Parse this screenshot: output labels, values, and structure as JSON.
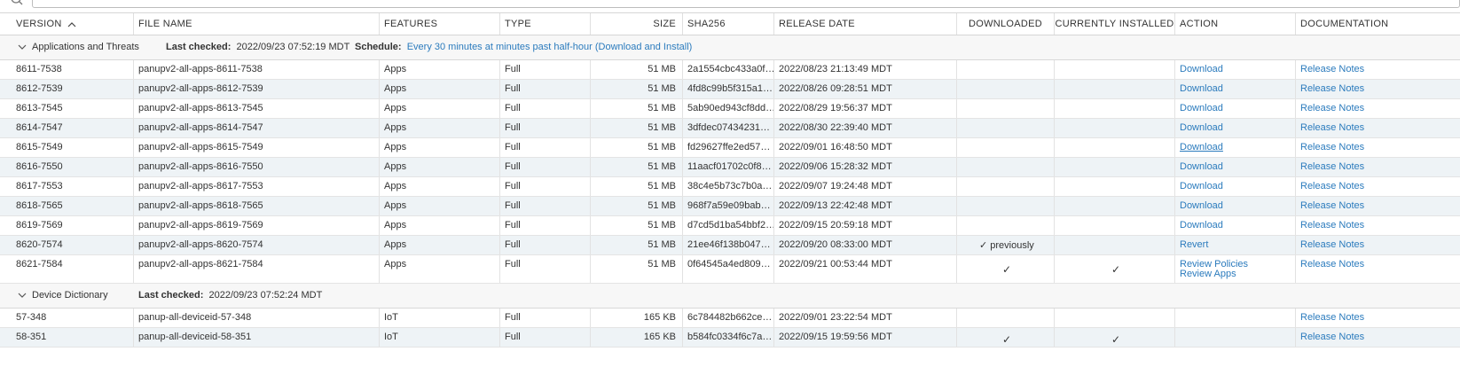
{
  "headers": {
    "version": "VERSION",
    "file_name": "FILE NAME",
    "features": "FEATURES",
    "type": "TYPE",
    "size": "SIZE",
    "sha256": "SHA256",
    "release_date": "RELEASE DATE",
    "downloaded": "DOWNLOADED",
    "currently_installed": "CURRENTLY INSTALLED",
    "action": "ACTION",
    "documentation": "DOCUMENTATION"
  },
  "groups": [
    {
      "name": "Applications and Threats",
      "last_checked_label": "Last checked:",
      "last_checked_value": "2022/09/23 07:52:19 MDT",
      "schedule_label": "Schedule:",
      "schedule_value": "Every 30 minutes at minutes past half-hour (Download and Install)",
      "rows": [
        {
          "version": "8611-7538",
          "file": "panupv2-all-apps-8611-7538",
          "features": "Apps",
          "type": "Full",
          "size": "51 MB",
          "sha": "2a1554cbc433a0f…",
          "date": "2022/08/23 21:13:49 MDT",
          "downloaded": "",
          "installed": "",
          "action": "Download",
          "action2": "",
          "doc": "Release Notes"
        },
        {
          "version": "8612-7539",
          "file": "panupv2-all-apps-8612-7539",
          "features": "Apps",
          "type": "Full",
          "size": "51 MB",
          "sha": "4fd8c99b5f315a1…",
          "date": "2022/08/26 09:28:51 MDT",
          "downloaded": "",
          "installed": "",
          "action": "Download",
          "action2": "",
          "doc": "Release Notes"
        },
        {
          "version": "8613-7545",
          "file": "panupv2-all-apps-8613-7545",
          "features": "Apps",
          "type": "Full",
          "size": "51 MB",
          "sha": "5ab90ed943cf8dd…",
          "date": "2022/08/29 19:56:37 MDT",
          "downloaded": "",
          "installed": "",
          "action": "Download",
          "action2": "",
          "doc": "Release Notes"
        },
        {
          "version": "8614-7547",
          "file": "panupv2-all-apps-8614-7547",
          "features": "Apps",
          "type": "Full",
          "size": "51 MB",
          "sha": "3dfdec07434231…",
          "date": "2022/08/30 22:39:40 MDT",
          "downloaded": "",
          "installed": "",
          "action": "Download",
          "action2": "",
          "doc": "Release Notes"
        },
        {
          "version": "8615-7549",
          "file": "panupv2-all-apps-8615-7549",
          "features": "Apps",
          "type": "Full",
          "size": "51 MB",
          "sha": "fd29627ffe2ed57…",
          "date": "2022/09/01 16:48:50 MDT",
          "downloaded": "",
          "installed": "",
          "action": "Download",
          "action2": "",
          "doc": "Release Notes",
          "hover": true
        },
        {
          "version": "8616-7550",
          "file": "panupv2-all-apps-8616-7550",
          "features": "Apps",
          "type": "Full",
          "size": "51 MB",
          "sha": "11aacf01702c0f8…",
          "date": "2022/09/06 15:28:32 MDT",
          "downloaded": "",
          "installed": "",
          "action": "Download",
          "action2": "",
          "doc": "Release Notes"
        },
        {
          "version": "8617-7553",
          "file": "panupv2-all-apps-8617-7553",
          "features": "Apps",
          "type": "Full",
          "size": "51 MB",
          "sha": "38c4e5b73c7b0a…",
          "date": "2022/09/07 19:24:48 MDT",
          "downloaded": "",
          "installed": "",
          "action": "Download",
          "action2": "",
          "doc": "Release Notes"
        },
        {
          "version": "8618-7565",
          "file": "panupv2-all-apps-8618-7565",
          "features": "Apps",
          "type": "Full",
          "size": "51 MB",
          "sha": "968f7a59e09bab…",
          "date": "2022/09/13 22:42:48 MDT",
          "downloaded": "",
          "installed": "",
          "action": "Download",
          "action2": "",
          "doc": "Release Notes"
        },
        {
          "version": "8619-7569",
          "file": "panupv2-all-apps-8619-7569",
          "features": "Apps",
          "type": "Full",
          "size": "51 MB",
          "sha": "d7cd5d1ba54bbf2…",
          "date": "2022/09/15 20:59:18 MDT",
          "downloaded": "",
          "installed": "",
          "action": "Download",
          "action2": "",
          "doc": "Release Notes"
        },
        {
          "version": "8620-7574",
          "file": "panupv2-all-apps-8620-7574",
          "features": "Apps",
          "type": "Full",
          "size": "51 MB",
          "sha": "21ee46f138b047…",
          "date": "2022/09/20 08:33:00 MDT",
          "downloaded": "✓ previously",
          "installed": "",
          "action": "Revert",
          "action2": "",
          "doc": "Release Notes"
        },
        {
          "version": "8621-7584",
          "file": "panupv2-all-apps-8621-7584",
          "features": "Apps",
          "type": "Full",
          "size": "51 MB",
          "sha": "0f64545a4ed809…",
          "date": "2022/09/21 00:53:44 MDT",
          "downloaded": "✓",
          "installed": "✓",
          "action": "Review Policies",
          "action2": "Review Apps",
          "doc": "Release Notes"
        }
      ]
    },
    {
      "name": "Device Dictionary",
      "last_checked_label": "Last checked:",
      "last_checked_value": "2022/09/23 07:52:24 MDT",
      "rows": [
        {
          "version": "57-348",
          "file": "panup-all-deviceid-57-348",
          "features": "IoT",
          "type": "Full",
          "size": "165 KB",
          "sha": "6c784482b662ce…",
          "date": "2022/09/01 23:22:54 MDT",
          "downloaded": "",
          "installed": "",
          "action": "",
          "action2": "",
          "doc": "Release Notes"
        },
        {
          "version": "58-351",
          "file": "panup-all-deviceid-58-351",
          "features": "IoT",
          "type": "Full",
          "size": "165 KB",
          "sha": "b584fc0334f6c7a…",
          "date": "2022/09/15 19:59:56 MDT",
          "downloaded": "✓",
          "installed": "✓",
          "action": "",
          "action2": "",
          "doc": "Release Notes"
        }
      ]
    }
  ]
}
